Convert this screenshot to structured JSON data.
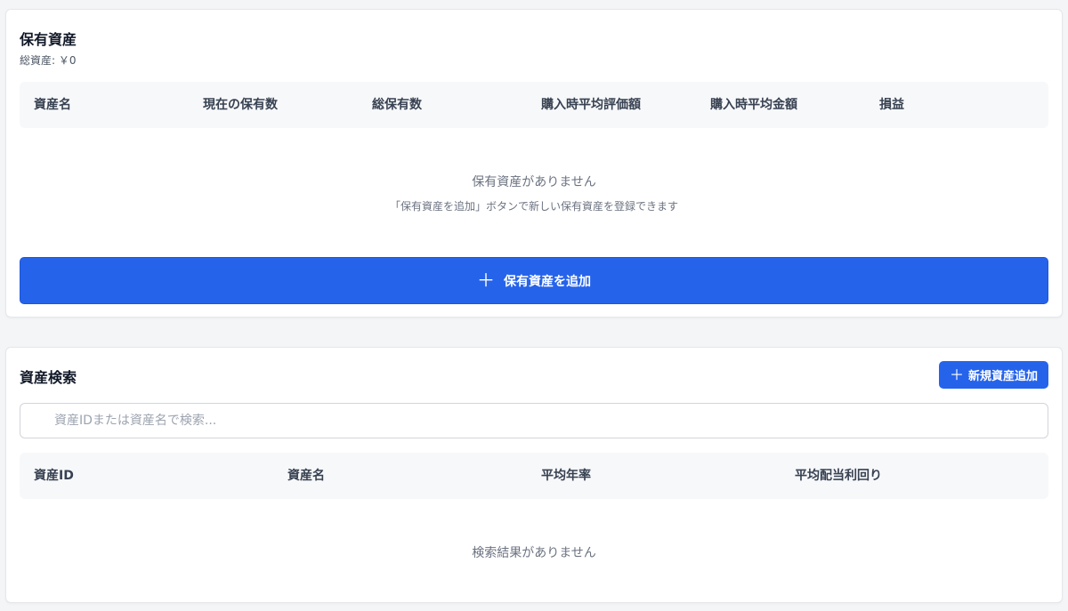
{
  "holdings": {
    "title": "保有資産",
    "total": "総資産: ￥0",
    "columns": [
      "資産名",
      "現在の保有数",
      "総保有数",
      "購入時平均評価額",
      "購入時平均金額",
      "損益"
    ],
    "empty_title": "保有資産がありません",
    "empty_hint": "「保有資産を追加」ボタンで新しい保有資産を登録できます",
    "add_button": "保有資産を追加"
  },
  "search": {
    "title": "資産検索",
    "new_button": "新規資産追加",
    "placeholder": "資産IDまたは資産名で検索...",
    "columns": [
      "資産ID",
      "資産名",
      "平均年率",
      "平均配当利回り"
    ],
    "empty_title": "検索結果がありません"
  },
  "colors": {
    "accent": "#2563eb",
    "background": "#f4f5f7",
    "card": "#ffffff"
  },
  "icons": {
    "add": "plus-icon"
  }
}
